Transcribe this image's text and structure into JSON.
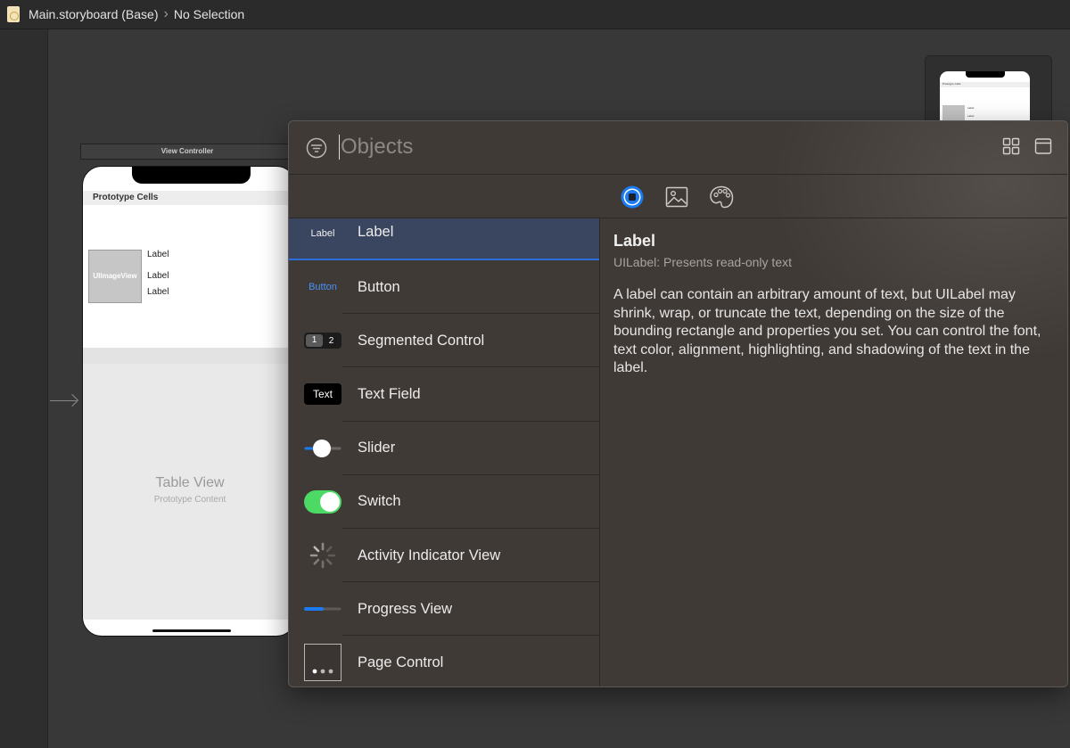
{
  "jumpbar": {
    "file_name": "Main.storyboard (Base)",
    "selection": "No Selection"
  },
  "canvas": {
    "view_controller_title": "View Controller",
    "prototype_cells_header": "Prototype Cells",
    "image_view_label": "UIImageView",
    "cell_labels": [
      "Label",
      "Label",
      "Label"
    ],
    "table_view_title": "Table View",
    "table_view_subtitle": "Prototype Content",
    "mini_header": "Prototype Cells",
    "mini_labels": [
      "Label",
      "Label"
    ]
  },
  "library": {
    "search": {
      "placeholder": "Objects",
      "value": ""
    },
    "tabs": [
      {
        "name": "objects",
        "icon": "square-circle-icon",
        "active": true
      },
      {
        "name": "media",
        "icon": "photo-icon",
        "active": false
      },
      {
        "name": "colors",
        "icon": "palette-icon",
        "active": false
      }
    ],
    "items": [
      {
        "label": "Label",
        "thumb_text": "Label",
        "icon": "label-thumb",
        "selected": true
      },
      {
        "label": "Button",
        "thumb_text": "Button",
        "icon": "button-thumb",
        "selected": false
      },
      {
        "label": "Segmented Control",
        "thumb_segments": [
          "1",
          "2"
        ],
        "icon": "segmented-control-thumb",
        "selected": false
      },
      {
        "label": "Text Field",
        "thumb_text": "Text",
        "icon": "text-field-thumb",
        "selected": false
      },
      {
        "label": "Slider",
        "icon": "slider-thumb",
        "selected": false
      },
      {
        "label": "Switch",
        "icon": "switch-thumb",
        "selected": false
      },
      {
        "label": "Activity Indicator View",
        "icon": "activity-indicator-thumb",
        "selected": false
      },
      {
        "label": "Progress View",
        "icon": "progress-view-thumb",
        "selected": false
      },
      {
        "label": "Page Control",
        "icon": "page-control-thumb",
        "selected": false
      }
    ],
    "detail": {
      "title": "Label",
      "subtitle": "UILabel: Presents read-only text",
      "description": "A label can contain an arbitrary amount of text, but UILabel may shrink, wrap, or truncate the text, depending on the size of the bounding rectangle and properties you set. You can control the font, text color, alignment, highlighting, and shadowing of the text in the label."
    }
  },
  "colors": {
    "accent": "#1a7bf2",
    "selection_bg": "#3a4660",
    "switch_on": "#4cd964",
    "popover_bg": "#403a36"
  }
}
